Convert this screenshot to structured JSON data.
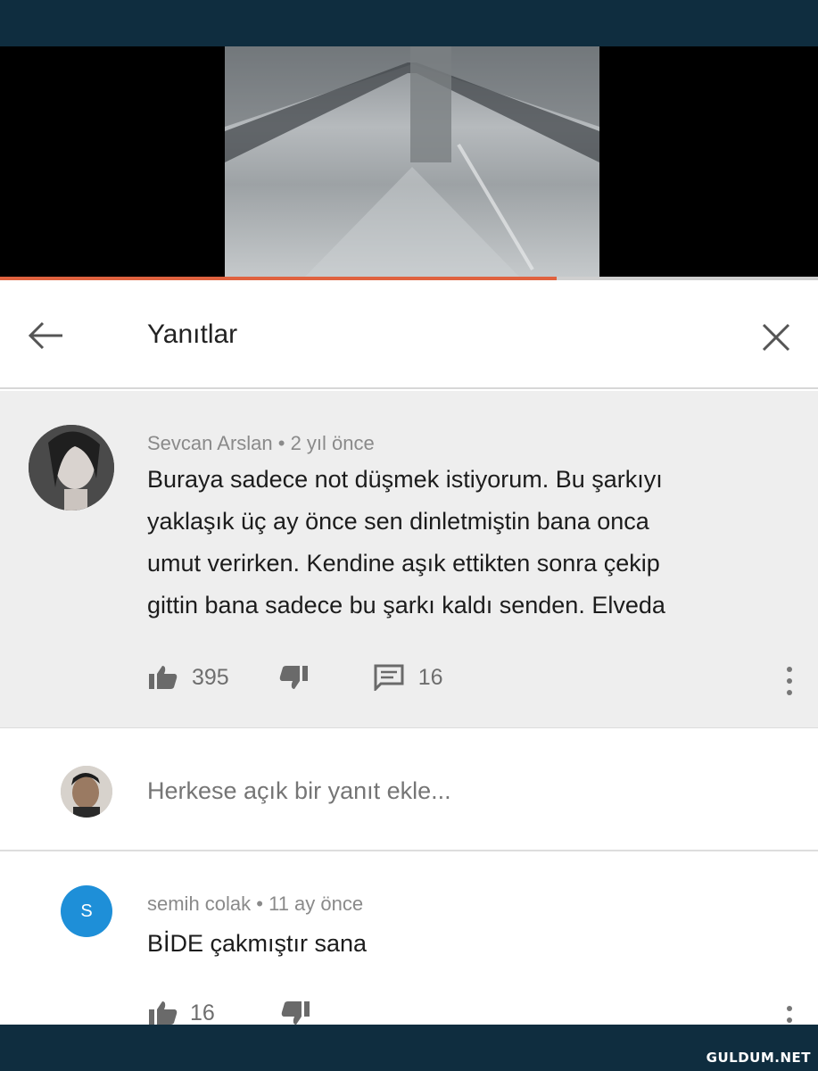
{
  "header": {
    "title": "Yanıtlar"
  },
  "video": {
    "progress_fraction": 0.68
  },
  "comment": {
    "author": "Sevcan Arslan",
    "separator": " • ",
    "time": "2 yıl önce",
    "lines": [
      "Buraya sadece not düşmek istiyorum. Bu şarkıyı",
      "yaklaşık üç ay önce sen dinletmiştin bana onca",
      "umut verirken. Kendine aşık ettikten sonra çekip",
      "gittin bana sadece bu şarkı kaldı senden. Elveda"
    ],
    "likes": "395",
    "replies": "16"
  },
  "reply_box": {
    "placeholder": "Herkese açık bir yanıt ekle..."
  },
  "reply": {
    "avatar_letter": "S",
    "author": "semih colak",
    "separator": " • ",
    "time": "11 ay önce",
    "text": "BİDE  çakmıştır sana",
    "likes": "16"
  },
  "colors": {
    "progress": "#e0623f",
    "band": "#0f2d3f",
    "reply_avatar": "#1e8fd8"
  },
  "icons": [
    "back-arrow-icon",
    "close-icon",
    "thumbs-up-icon",
    "thumbs-down-icon",
    "reply-icon",
    "more-vertical-icon"
  ],
  "watermark": "GULDUM.NET"
}
